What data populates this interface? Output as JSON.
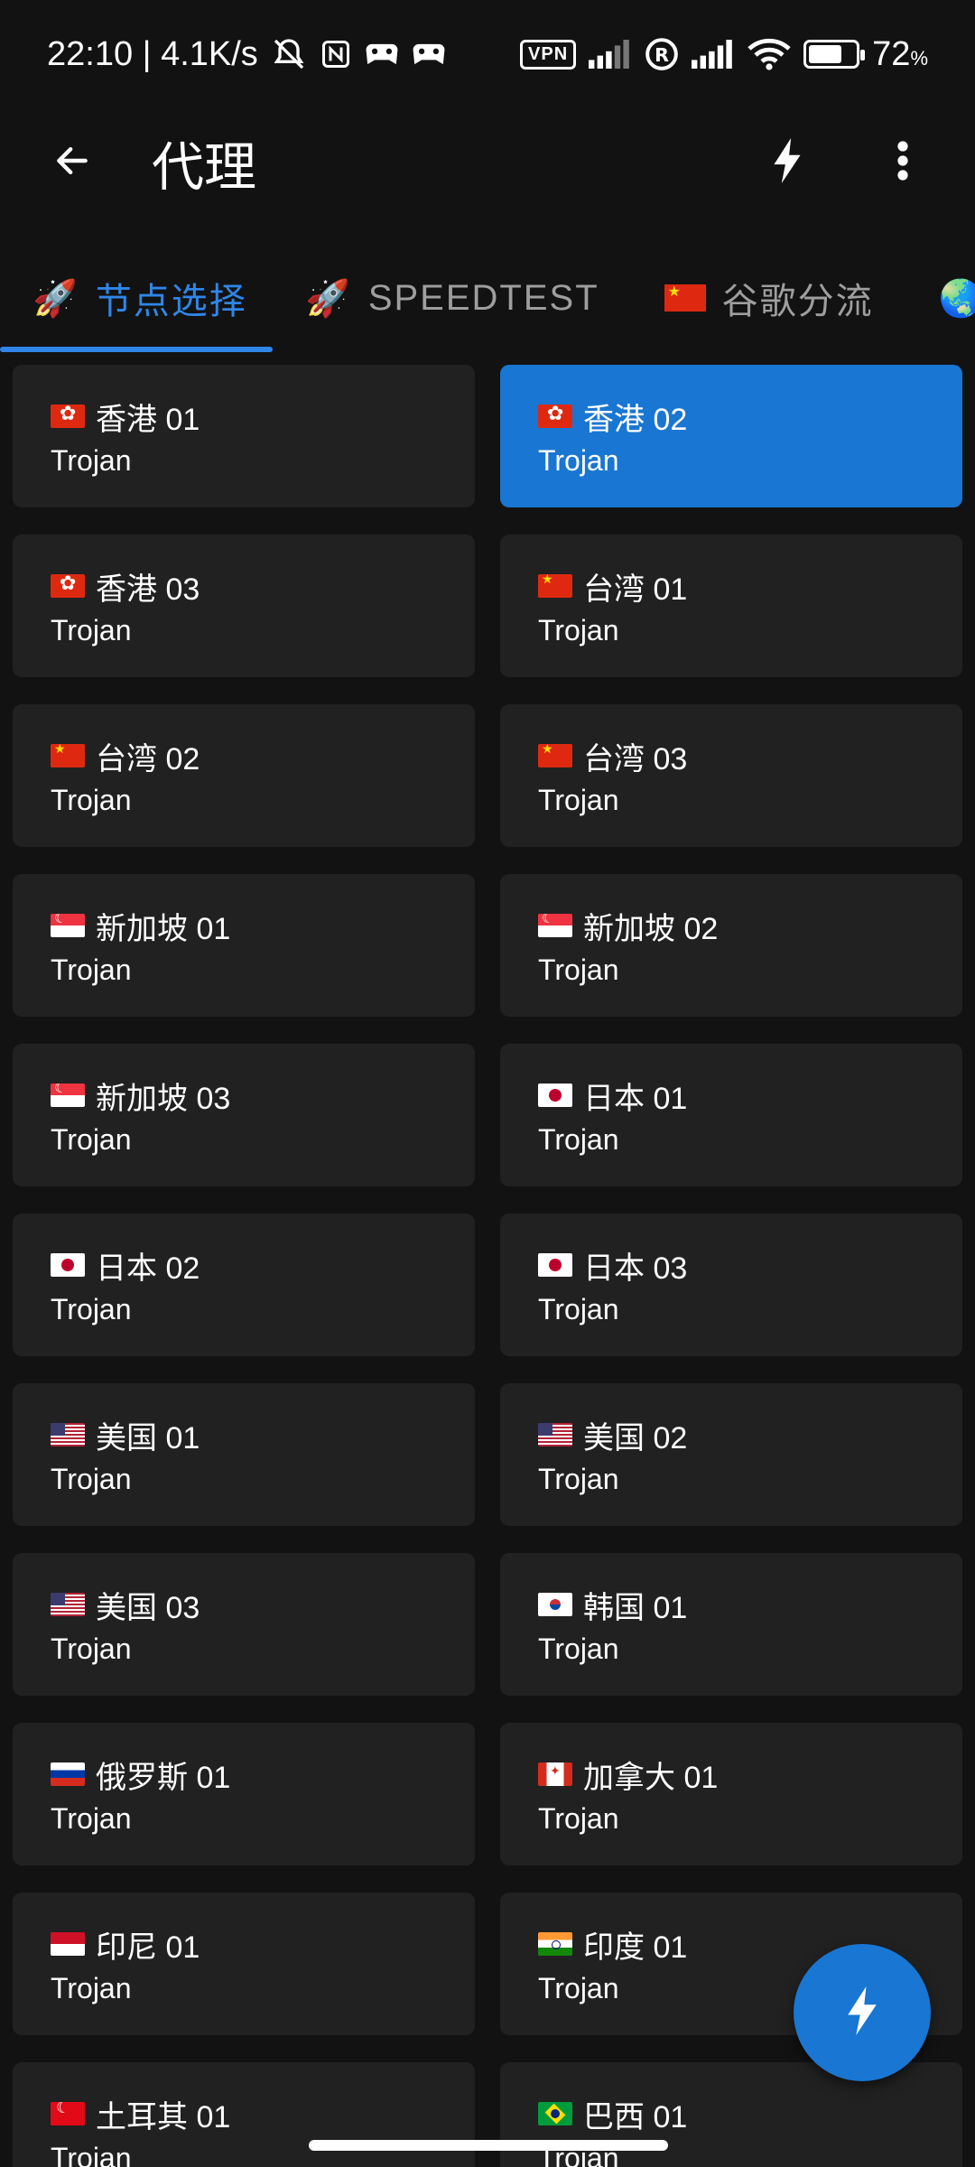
{
  "status_bar": {
    "time_speed": "22:10 | 4.1K/s",
    "vpn": "VPN",
    "battery": "72",
    "battery_unit": "%",
    "battery_level": 0.72,
    "icons": [
      "bell-off-icon",
      "nfc-icon",
      "game-icon",
      "game-icon",
      "signal-icon",
      "registered-icon",
      "wifi-icon",
      "battery-icon"
    ]
  },
  "app_bar": {
    "title": "代理",
    "back_icon": "arrow-back-icon",
    "lightning_icon": "lightning-icon",
    "more_icon": "more-vert-icon"
  },
  "tabs": [
    {
      "emoji": "🚀",
      "label": "节点选择",
      "active": true
    },
    {
      "emoji": "🚀",
      "label": "SPEEDTEST",
      "active": false
    },
    {
      "flag": "cn",
      "label": "谷歌分流",
      "active": false
    },
    {
      "emoji": "🌏",
      "label": "",
      "active": false
    }
  ],
  "nodes": [
    {
      "flag": "hk",
      "name": "香港 01",
      "type": "Trojan",
      "selected": false
    },
    {
      "flag": "hk",
      "name": "香港 02",
      "type": "Trojan",
      "selected": true
    },
    {
      "flag": "hk",
      "name": "香港 03",
      "type": "Trojan",
      "selected": false
    },
    {
      "flag": "cn",
      "name": "台湾 01",
      "type": "Trojan",
      "selected": false
    },
    {
      "flag": "cn",
      "name": "台湾 02",
      "type": "Trojan",
      "selected": false
    },
    {
      "flag": "cn",
      "name": "台湾 03",
      "type": "Trojan",
      "selected": false
    },
    {
      "flag": "sg",
      "name": "新加坡 01",
      "type": "Trojan",
      "selected": false
    },
    {
      "flag": "sg",
      "name": "新加坡 02",
      "type": "Trojan",
      "selected": false
    },
    {
      "flag": "sg",
      "name": "新加坡 03",
      "type": "Trojan",
      "selected": false
    },
    {
      "flag": "jp",
      "name": "日本 01",
      "type": "Trojan",
      "selected": false
    },
    {
      "flag": "jp",
      "name": "日本 02",
      "type": "Trojan",
      "selected": false
    },
    {
      "flag": "jp",
      "name": "日本 03",
      "type": "Trojan",
      "selected": false
    },
    {
      "flag": "us",
      "name": "美国 01",
      "type": "Trojan",
      "selected": false
    },
    {
      "flag": "us",
      "name": "美国 02",
      "type": "Trojan",
      "selected": false
    },
    {
      "flag": "us",
      "name": "美国 03",
      "type": "Trojan",
      "selected": false
    },
    {
      "flag": "kr",
      "name": "韩国 01",
      "type": "Trojan",
      "selected": false
    },
    {
      "flag": "ru",
      "name": "俄罗斯 01",
      "type": "Trojan",
      "selected": false
    },
    {
      "flag": "ca",
      "name": "加拿大 01",
      "type": "Trojan",
      "selected": false
    },
    {
      "flag": "id",
      "name": "印尼 01",
      "type": "Trojan",
      "selected": false
    },
    {
      "flag": "in",
      "name": "印度 01",
      "type": "Trojan",
      "selected": false
    },
    {
      "flag": "tr",
      "name": "土耳其 01",
      "type": "Trojan",
      "selected": false
    },
    {
      "flag": "br",
      "name": "巴西 01",
      "type": "Trojan",
      "selected": false
    }
  ],
  "fab": {
    "icon": "lightning-icon"
  },
  "colors": {
    "accent": "#1976d2",
    "tab_active": "#2f86e8",
    "card": "#212121",
    "background": "#121212"
  }
}
